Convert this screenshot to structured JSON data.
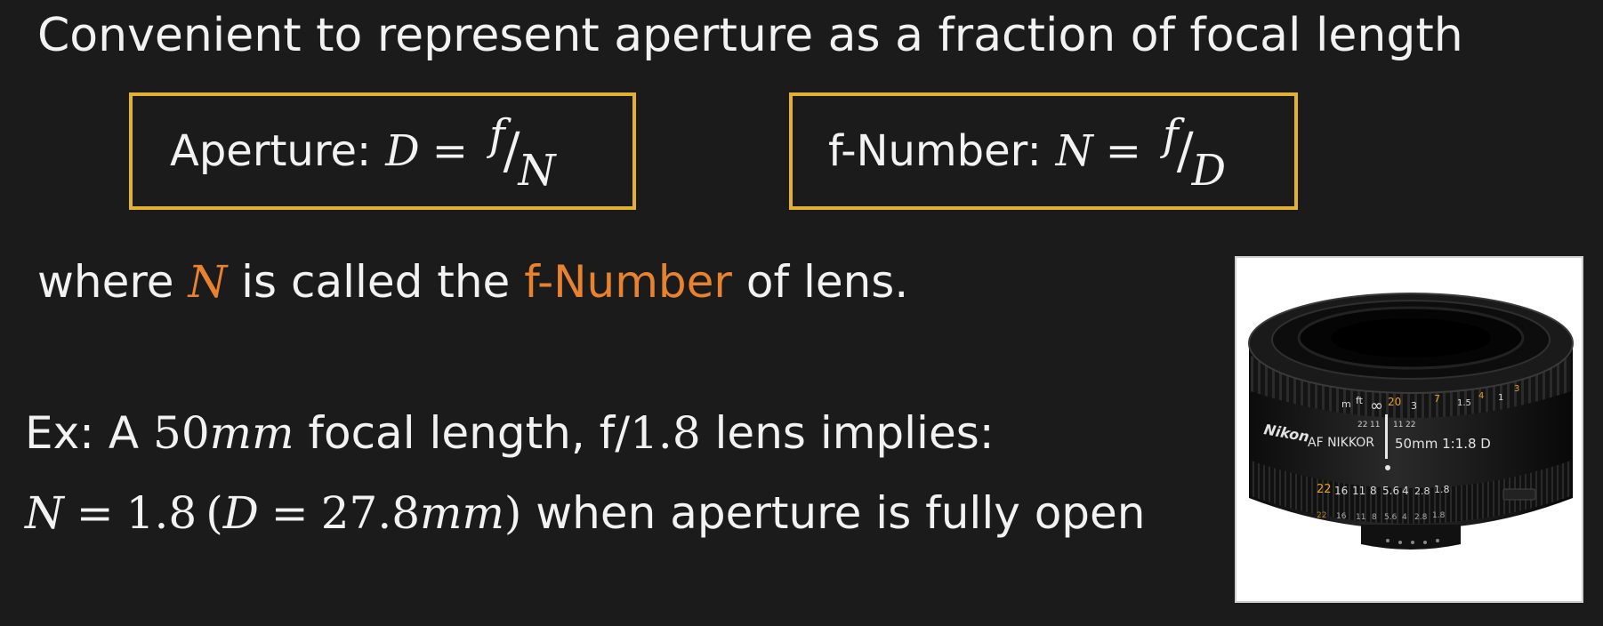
{
  "slide": {
    "title": "Convenient to represent aperture as a fraction of focal length"
  },
  "formulas": {
    "aperture": {
      "label": "Aperture:",
      "lhs": "D",
      "eq": "=",
      "num": "f",
      "slash": "/",
      "den": "N"
    },
    "fnumber": {
      "label": "f-Number:",
      "lhs": "N",
      "eq": "=",
      "num": "f",
      "slash": "/",
      "den": "D"
    }
  },
  "definition": {
    "pre": "where ",
    "var": "N",
    "mid": " is called the ",
    "term": "f-Number",
    "post": " of lens."
  },
  "example": {
    "line1_pre": "Ex: A ",
    "line1_value": "50",
    "line1_unit": "mm",
    "line1_mid": " focal length, f/",
    "line1_fnum": "1.8",
    "line1_post": " lens implies:",
    "line2_n": "N",
    "line2_eq": "=",
    "line2_val": "1.8",
    "line2_open": "(",
    "line2_d": "D",
    "line2_eq2": "=",
    "line2_dval": "27.8",
    "line2_unit": "mm",
    "line2_close": ")",
    "line2_post": " when aperture is fully open"
  },
  "lens_image": {
    "brand": "Nikon",
    "model": "AF NIKKOR",
    "spec": "50mm  1:1.8 D",
    "distance_scale": [
      "m",
      "ft",
      "∞",
      "20",
      "3",
      "7",
      "1.5",
      "4",
      "1",
      "3"
    ],
    "dof_scale": [
      "22",
      "11",
      "11",
      "22"
    ],
    "aperture_scale": [
      "22",
      "16",
      "11",
      "8",
      "5.6",
      "4",
      "2.8",
      "1.8"
    ],
    "colors": {
      "accent": "#e8822e",
      "box_border": "#e1b12f"
    }
  }
}
